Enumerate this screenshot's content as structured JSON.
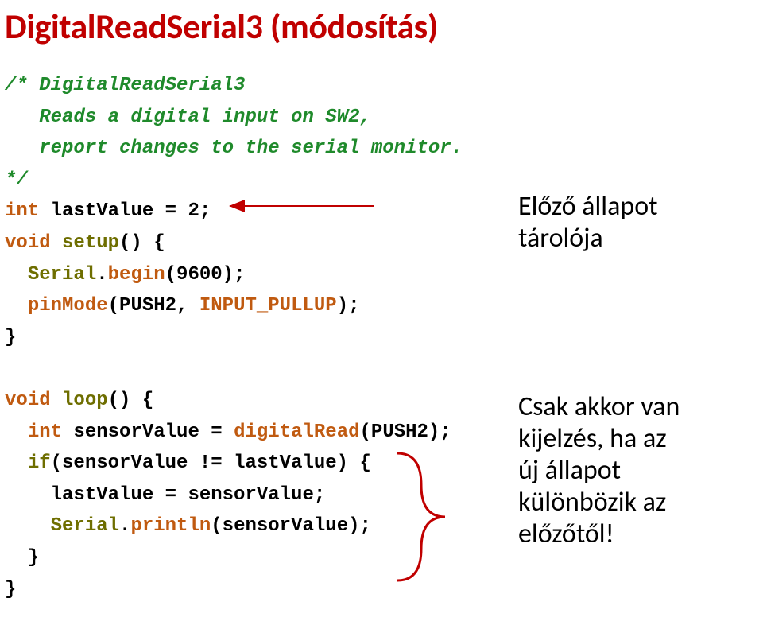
{
  "title": "DigitalReadSerial3 (módosítás)",
  "code": {
    "l1": "/* DigitalReadSerial3",
    "l2": "   Reads a digital input on SW2,",
    "l3": "   report changes to the serial monitor.",
    "l4": "*/",
    "l5a": "int",
    "l5b": " lastValue = 2;",
    "l6a": "void",
    "l6b": " ",
    "l6c": "setup",
    "l6d": "() {",
    "l7a": "  ",
    "l7b": "Serial",
    "l7c": ".",
    "l7d": "begin",
    "l7e": "(9600);",
    "l8a": "  ",
    "l8b": "pinMode",
    "l8c": "(PUSH2, ",
    "l8d": "INPUT_PULLUP",
    "l8e": ");",
    "l9": "}",
    "l11a": "void",
    "l11b": " ",
    "l11c": "loop",
    "l11d": "() {",
    "l12a": "  ",
    "l12b": "int",
    "l12c": " sensorValue = ",
    "l12d": "digitalRead",
    "l12e": "(PUSH2);",
    "l13a": "  ",
    "l13b": "if",
    "l13c": "(sensorValue != lastValue) {",
    "l14": "    lastValue = sensorValue;",
    "l15a": "    ",
    "l15b": "Serial",
    "l15c": ".",
    "l15d": "println",
    "l15e": "(sensorValue);",
    "l16": "  }",
    "l17": "}"
  },
  "annotations": {
    "a1l1": "Előző állapot",
    "a1l2": "tárolója",
    "a2l1": "Csak akkor van",
    "a2l2": "kijelzés, ha az",
    "a2l3": "új állapot",
    "a2l4": "különbözik az",
    "a2l5": "előzőtől!"
  }
}
